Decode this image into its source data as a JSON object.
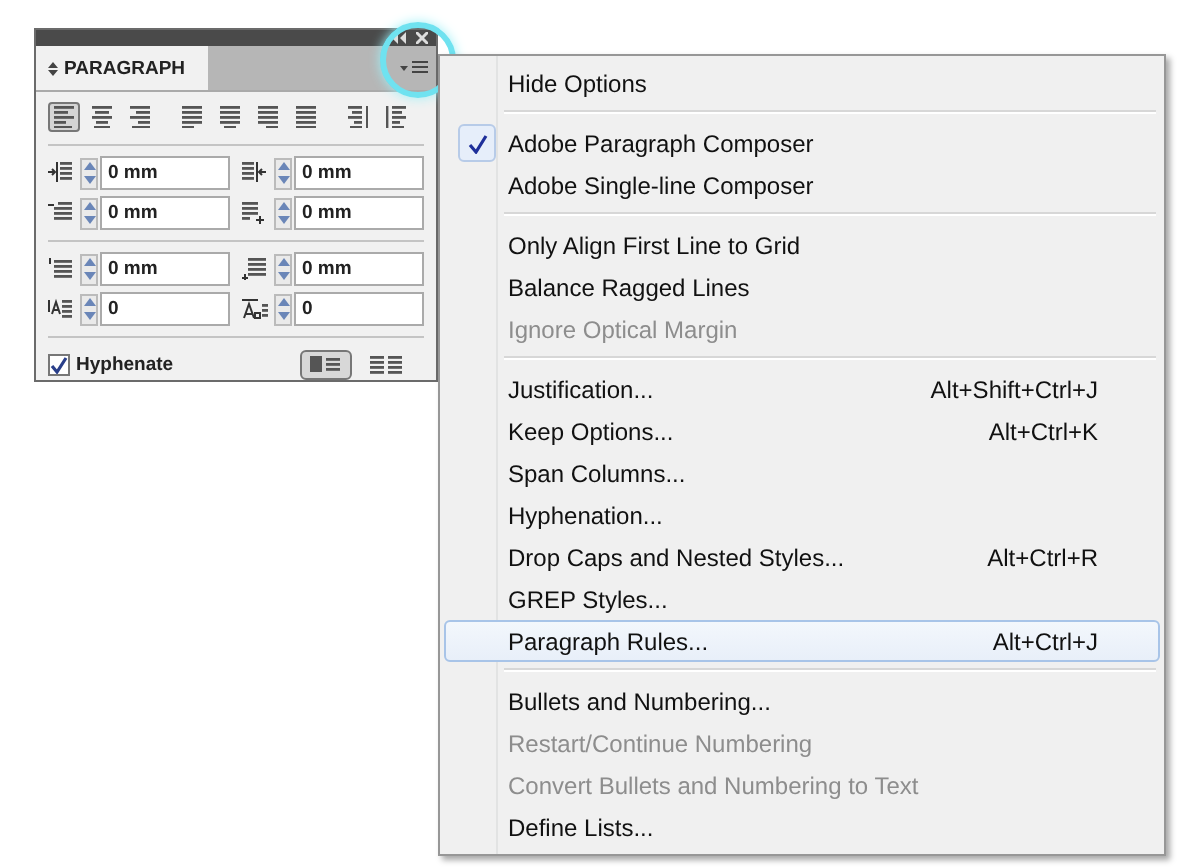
{
  "panel": {
    "tab": {
      "label": "PARAGRAPH",
      "selected": true
    },
    "alignments": [
      {
        "kind": "left",
        "selected": true
      },
      {
        "kind": "center",
        "selected": false
      },
      {
        "kind": "right",
        "selected": false
      },
      {
        "kind": "justify-left",
        "selected": false
      },
      {
        "kind": "justify-center",
        "selected": false
      },
      {
        "kind": "justify-right",
        "selected": false
      },
      {
        "kind": "justify-all",
        "selected": false
      },
      {
        "kind": "toward-spine",
        "selected": false
      },
      {
        "kind": "away-spine",
        "selected": false
      }
    ],
    "field_groups": [
      [
        {
          "kind": "left-indent",
          "value": "0 mm"
        },
        {
          "kind": "right-indent",
          "value": "0 mm"
        },
        {
          "kind": "first-line-indent",
          "value": "0 mm"
        },
        {
          "kind": "last-line-indent",
          "value": "0 mm"
        }
      ],
      [
        {
          "kind": "space-before",
          "value": "0 mm"
        },
        {
          "kind": "space-after",
          "value": "0 mm"
        },
        {
          "kind": "drop-cap-lines",
          "value": "0"
        },
        {
          "kind": "drop-cap-chars",
          "value": "0"
        }
      ]
    ],
    "hyphenate": {
      "label": "Hyphenate",
      "checked": true
    },
    "span_modes": [
      {
        "kind": "single",
        "selected": true
      },
      {
        "kind": "split",
        "selected": false
      }
    ]
  },
  "menu": {
    "groups": [
      [
        {
          "label": "Hide Options",
          "disabled": false,
          "checked": false,
          "selected": false
        }
      ],
      [
        {
          "label": "Adobe Paragraph Composer",
          "disabled": false,
          "checked": true,
          "selected": false
        },
        {
          "label": "Adobe Single-line Composer",
          "disabled": false,
          "checked": false,
          "selected": false
        }
      ],
      [
        {
          "label": "Only Align First Line to Grid",
          "disabled": false,
          "checked": false,
          "selected": false
        },
        {
          "label": "Balance Ragged Lines",
          "disabled": false,
          "checked": false,
          "selected": false
        },
        {
          "label": "Ignore Optical Margin",
          "disabled": true,
          "checked": false,
          "selected": false
        }
      ],
      [
        {
          "label": "Justification...",
          "shortcut": "Alt+Shift+Ctrl+J",
          "disabled": false,
          "checked": false,
          "selected": false
        },
        {
          "label": "Keep Options...",
          "shortcut": "Alt+Ctrl+K",
          "disabled": false,
          "checked": false,
          "selected": false
        },
        {
          "label": "Span Columns...",
          "disabled": false,
          "checked": false,
          "selected": false
        },
        {
          "label": "Hyphenation...",
          "disabled": false,
          "checked": false,
          "selected": false
        },
        {
          "label": "Drop Caps and Nested Styles...",
          "shortcut": "Alt+Ctrl+R",
          "disabled": false,
          "checked": false,
          "selected": false
        },
        {
          "label": "GREP Styles...",
          "disabled": false,
          "checked": false,
          "selected": false
        },
        {
          "label": "Paragraph Rules...",
          "shortcut": "Alt+Ctrl+J",
          "disabled": false,
          "checked": false,
          "selected": true
        }
      ],
      [
        {
          "label": "Bullets and Numbering...",
          "disabled": false,
          "checked": false,
          "selected": false
        },
        {
          "label": "Restart/Continue Numbering",
          "disabled": true,
          "checked": false,
          "selected": false
        },
        {
          "label": "Convert Bullets and Numbering to Text",
          "disabled": true,
          "checked": false,
          "selected": false
        },
        {
          "label": "Define Lists...",
          "disabled": false,
          "checked": false,
          "selected": false
        }
      ]
    ]
  }
}
